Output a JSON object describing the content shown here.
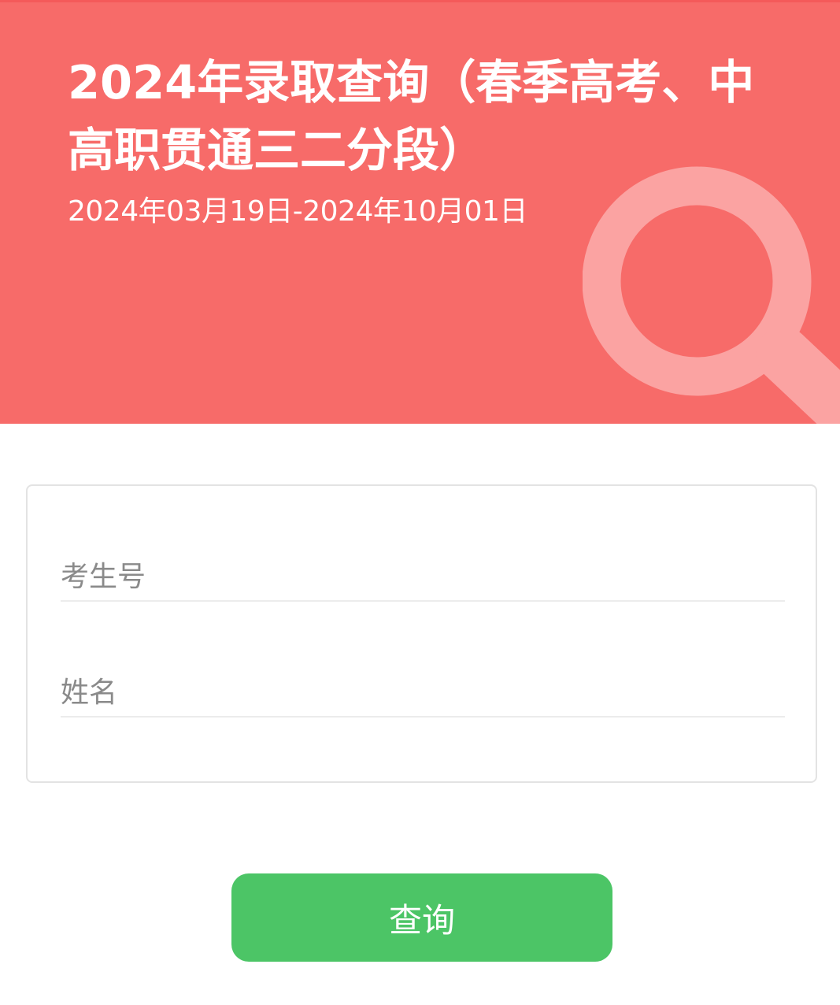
{
  "colors": {
    "header_background": "#f76b69",
    "magnifier": "#fba3a2",
    "button_background": "#4cc566"
  },
  "header": {
    "title": "2024年录取查询（春季高考、中高职贯通三二分段）",
    "date_range": "2024年03月19日-2024年10月01日",
    "decoration_icon": "magnifier-icon"
  },
  "form": {
    "candidate_number_placeholder": "考生号",
    "candidate_number_value": "",
    "name_placeholder": "姓名",
    "name_value": ""
  },
  "actions": {
    "query_label": "查询"
  }
}
